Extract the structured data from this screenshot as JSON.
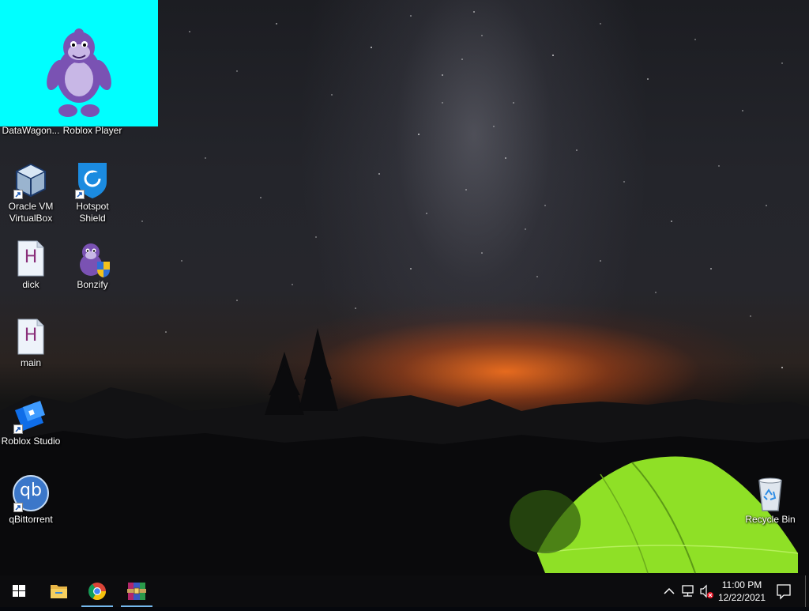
{
  "desktop": {
    "icons": [
      {
        "id": "datawagon",
        "label": "DataWagon..."
      },
      {
        "id": "roblox-player",
        "label": "Roblox Player"
      },
      {
        "id": "virtualbox",
        "label": "Oracle VM VirtualBox"
      },
      {
        "id": "hotspot-shield",
        "label": "Hotspot Shield"
      },
      {
        "id": "dick",
        "label": "dick"
      },
      {
        "id": "bonzify",
        "label": "Bonzify"
      },
      {
        "id": "main",
        "label": "main"
      },
      {
        "id": "roblox-studio",
        "label": "Roblox Studio"
      },
      {
        "id": "qbittorrent",
        "label": "qBittorrent"
      },
      {
        "id": "recycle-bin",
        "label": "Recycle Bin"
      }
    ],
    "html_file_glyph": "H",
    "qbittorrent_glyph": "qb"
  },
  "taskbar": {
    "pinned": [
      "start-icon",
      "file-explorer-icon",
      "chrome-icon",
      "winrar-icon"
    ],
    "clock": {
      "time": "11:00 PM",
      "date": "12/22/2021"
    }
  },
  "colors": {
    "bonzi_background": "#00ffff",
    "bonzi_purple": "#7a52b3",
    "taskbar": "#0c0c0e",
    "tent_green": "#8fe026",
    "active_underline": "#76b9ed"
  }
}
